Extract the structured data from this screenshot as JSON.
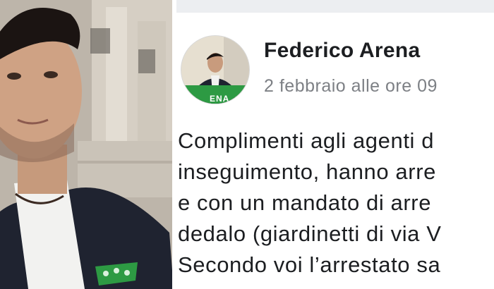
{
  "post": {
    "author_name": "Federico Arena",
    "date": "2 febbraio alle ore 09",
    "avatar_text": "ENA",
    "lines": [
      "Complimenti agli agenti d",
      "inseguimento, hanno arre",
      "e con un mandato di arre",
      "dedalo (giardinetti di via V",
      "Secondo voi l’arrestato sa"
    ]
  },
  "colors": {
    "facebook_text": "#1c1e21",
    "date_gray": "#7d8085",
    "banner_green": "#2d9a43",
    "jacket_navy": "#1f2330"
  }
}
